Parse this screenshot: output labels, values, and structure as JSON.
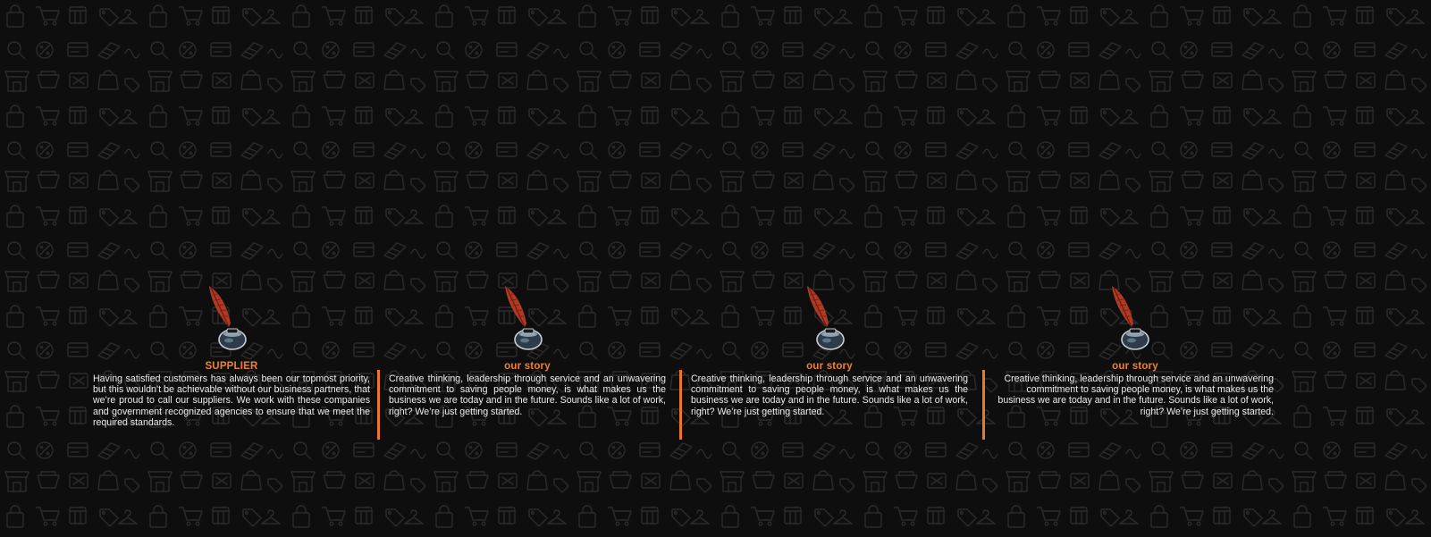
{
  "colors": {
    "background": "#0e0e0e",
    "pattern": "#2b2b2b",
    "accent": "#f08030",
    "divider": "#e8782a",
    "text": "#ececec"
  },
  "columns": [
    {
      "icon": "quill-inkpot-icon",
      "heading": "SUPPLIER",
      "body": "Having satisfied customers has always been our topmost priority, but this wouldn’t be achievable without our business partners, that we’re proud to call our suppliers. We work with these companies and government recognized agencies to ensure that we meet the required standards."
    },
    {
      "icon": "quill-inkpot-icon",
      "heading": "our story",
      "body": "Creative thinking, leadership through service and an unwavering commitment to saving people money, is what makes us the business we are today and in the future. Sounds like a lot of work, right? We’re just getting started."
    },
    {
      "icon": "quill-inkpot-icon",
      "heading": "our story",
      "body": "Creative thinking, leadership through service and an unwavering commitment to saving people money, is what makes us the business we are today and in the future. Sounds like a lot of work, right? We’re just getting started."
    },
    {
      "icon": "quill-inkpot-icon",
      "heading": "our story",
      "body": "Creative thinking, leadership through service and an unwavering commitment to saving people money, is what makes us the business we are today and in the future. Sounds like a lot of work, right? We’re just getting started."
    }
  ]
}
